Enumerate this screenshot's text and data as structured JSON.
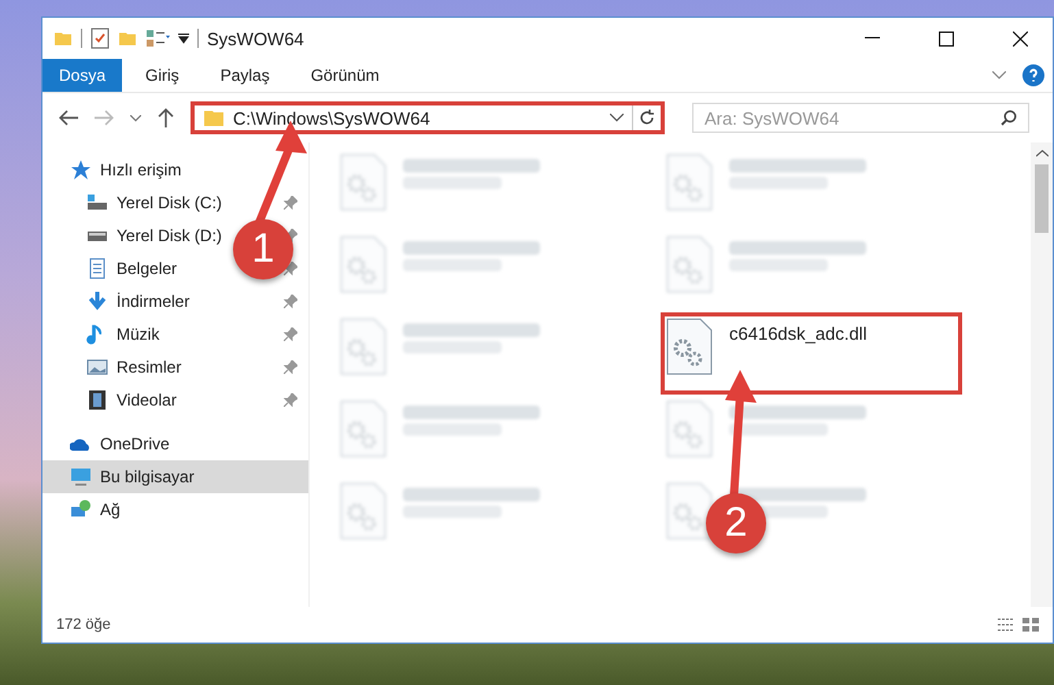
{
  "window": {
    "title": "SysWOW64"
  },
  "ribbon_tabs": [
    {
      "label": "Dosya",
      "selected": true
    },
    {
      "label": "Giriş",
      "selected": false
    },
    {
      "label": "Paylaş",
      "selected": false
    },
    {
      "label": "Görünüm",
      "selected": false
    }
  ],
  "address_bar": {
    "path": "C:\\Windows\\SysWOW64",
    "highlighted": true
  },
  "search": {
    "placeholder": "Ara: SysWOW64"
  },
  "sidebar": {
    "items": [
      {
        "label": "Hızlı erişim",
        "kind": "star",
        "selected": false,
        "children": [
          {
            "label": "Yerel Disk (C:)",
            "kind": "windrive",
            "pinned": true
          },
          {
            "label": "Yerel Disk (D:)",
            "kind": "drive",
            "pinned": true
          },
          {
            "label": "Belgeler",
            "kind": "docs",
            "pinned": true
          },
          {
            "label": "İndirmeler",
            "kind": "download",
            "pinned": true
          },
          {
            "label": "Müzik",
            "kind": "music",
            "pinned": true
          },
          {
            "label": "Resimler",
            "kind": "pictures",
            "pinned": true
          },
          {
            "label": "Videolar",
            "kind": "videos",
            "pinned": true
          }
        ]
      },
      {
        "label": "OneDrive",
        "kind": "cloud",
        "selected": false
      },
      {
        "label": "Bu bilgisayar",
        "kind": "pc",
        "selected": true
      },
      {
        "label": "Ağ",
        "kind": "network",
        "selected": false
      }
    ]
  },
  "files": [
    {
      "blurred": true,
      "highlighted": false
    },
    {
      "blurred": true,
      "highlighted": false
    },
    {
      "blurred": true,
      "highlighted": false
    },
    {
      "blurred": true,
      "highlighted": false
    },
    {
      "blurred": true,
      "highlighted": false
    },
    {
      "name": "c6416dsk_adc.dll",
      "blurred": false,
      "highlighted": true
    },
    {
      "blurred": true,
      "highlighted": false
    },
    {
      "blurred": true,
      "highlighted": false
    },
    {
      "blurred": true,
      "highlighted": false
    },
    {
      "blurred": true,
      "highlighted": false
    }
  ],
  "status_bar": {
    "count": "172 öğe"
  },
  "callouts": [
    {
      "number": "1"
    },
    {
      "number": "2"
    }
  ]
}
